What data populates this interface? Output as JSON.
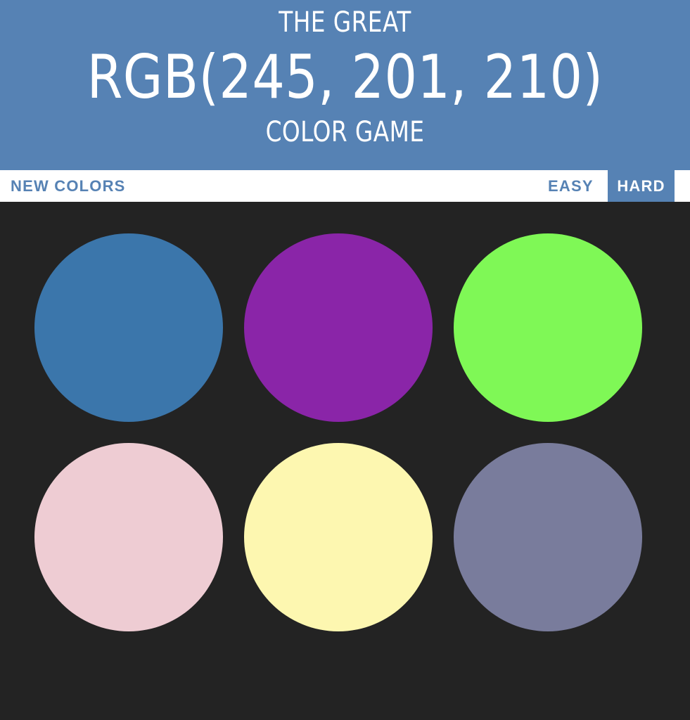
{
  "header": {
    "title_top": "THE GREAT",
    "rgb_display": "RGB(245, 201, 210)",
    "title_bottom": "COLOR GAME",
    "background_color": "#5682b4"
  },
  "stripe": {
    "new_colors_label": "NEW COLORS",
    "easy_label": "EASY",
    "hard_label": "HARD",
    "selected_mode": "HARD"
  },
  "squares": [
    {
      "color": "#3b76ab"
    },
    {
      "color": "#8a25a8"
    },
    {
      "color": "#7ff856"
    },
    {
      "color": "#eeccd3"
    },
    {
      "color": "#fdf7b0"
    },
    {
      "color": "#797c9c"
    }
  ],
  "background_color": "#232323"
}
